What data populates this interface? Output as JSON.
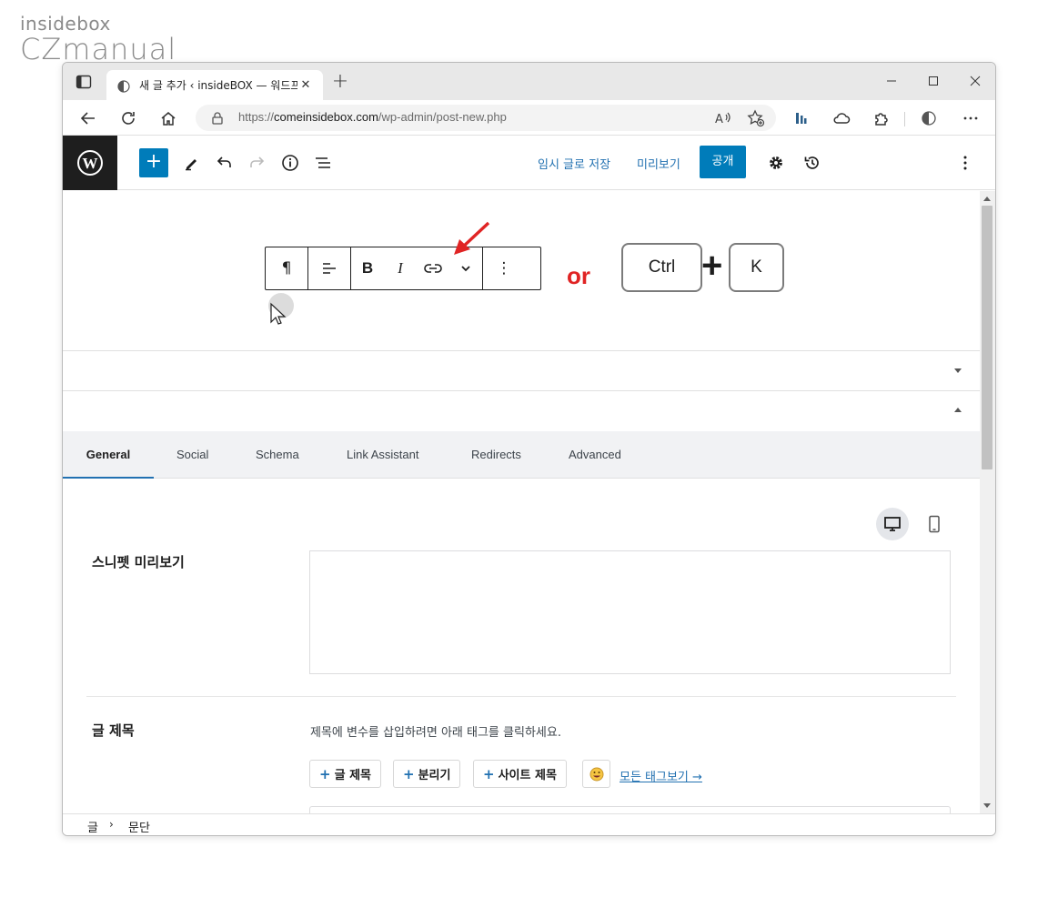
{
  "watermark": {
    "line1": "insidebox",
    "line2": "CZmanual"
  },
  "browser": {
    "tab_title": "새 글 추가 ‹ insideBOX — 워드프",
    "url_prefix": "https://",
    "url_host": "comeinsidebox.com",
    "url_path": "/wp-admin/post-new.php"
  },
  "wp_header": {
    "save_draft": "임시 글로 저장",
    "preview": "미리보기",
    "publish": "공개"
  },
  "block_toolbar": {
    "paragraph": "¶",
    "bold": "B",
    "italic": "I",
    "more": "⋮"
  },
  "shortcut": {
    "or": "or",
    "key1": "Ctrl",
    "plus": "+",
    "key2": "K"
  },
  "seo_tabs": [
    "General",
    "Social",
    "Schema",
    "Link Assistant",
    "Redirects",
    "Advanced"
  ],
  "seo": {
    "snippet_label": "스니펫 미리보기",
    "title_label": "글 제목",
    "title_help": "제목에 변수를 삽입하려면 아래 태그를 클릭하세요.",
    "tags": [
      "글 제목",
      "분리기",
      "사이트 제목"
    ],
    "all_tags": "모든 태그보기 →"
  },
  "breadcrumb": {
    "item1": "글",
    "sep": "›",
    "item2": "문단"
  },
  "colors": {
    "wp_blue": "#007cba",
    "link_blue": "#2271b1",
    "annotation_red": "#e02424"
  }
}
